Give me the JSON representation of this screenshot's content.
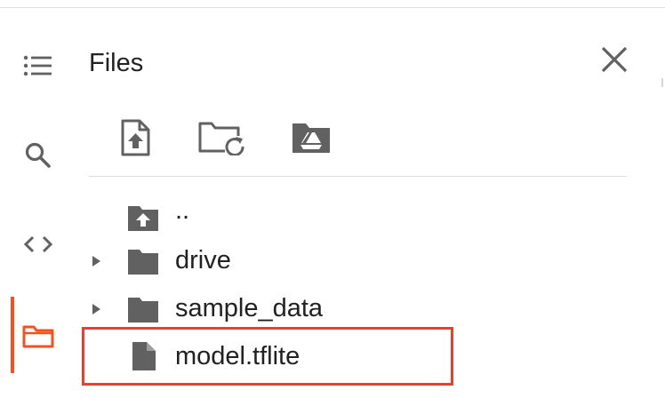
{
  "panel": {
    "title": "Files"
  },
  "rail": {
    "items": [
      {
        "name": "table-of-contents",
        "icon": "toc-icon"
      },
      {
        "name": "find-replace",
        "icon": "search-icon"
      },
      {
        "name": "code-snippets",
        "icon": "code-icon"
      },
      {
        "name": "files",
        "icon": "folder-icon",
        "active": true
      }
    ]
  },
  "toolbar": {
    "items": [
      {
        "name": "upload-file",
        "icon": "file-upload-icon"
      },
      {
        "name": "refresh",
        "icon": "folder-refresh-icon"
      },
      {
        "name": "mount-drive",
        "icon": "drive-folder-icon"
      }
    ]
  },
  "files": [
    {
      "name": "..",
      "type": "parent"
    },
    {
      "name": "drive",
      "type": "folder"
    },
    {
      "name": "sample_data",
      "type": "folder"
    },
    {
      "name": "model.tflite",
      "type": "file",
      "highlighted": true
    }
  ],
  "colors": {
    "accent": "#f4511e",
    "highlight_border": "#e8402d",
    "icon": "#616161",
    "text": "#212121"
  }
}
